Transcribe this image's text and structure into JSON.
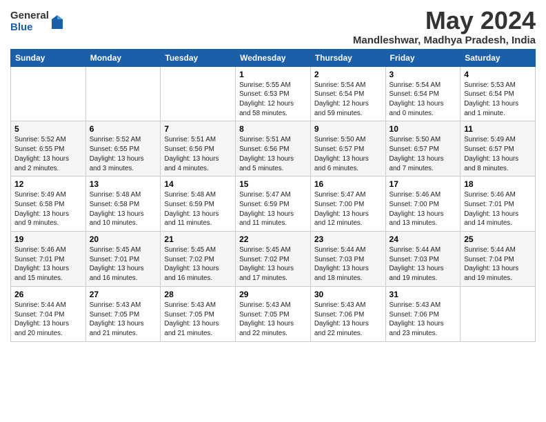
{
  "logo": {
    "general": "General",
    "blue": "Blue"
  },
  "title": "May 2024",
  "location": "Mandleshwar, Madhya Pradesh, India",
  "days_header": [
    "Sunday",
    "Monday",
    "Tuesday",
    "Wednesday",
    "Thursday",
    "Friday",
    "Saturday"
  ],
  "weeks": [
    [
      {
        "day": "",
        "info": ""
      },
      {
        "day": "",
        "info": ""
      },
      {
        "day": "",
        "info": ""
      },
      {
        "day": "1",
        "info": "Sunrise: 5:55 AM\nSunset: 6:53 PM\nDaylight: 12 hours\nand 58 minutes."
      },
      {
        "day": "2",
        "info": "Sunrise: 5:54 AM\nSunset: 6:54 PM\nDaylight: 12 hours\nand 59 minutes."
      },
      {
        "day": "3",
        "info": "Sunrise: 5:54 AM\nSunset: 6:54 PM\nDaylight: 13 hours\nand 0 minutes."
      },
      {
        "day": "4",
        "info": "Sunrise: 5:53 AM\nSunset: 6:54 PM\nDaylight: 13 hours\nand 1 minute."
      }
    ],
    [
      {
        "day": "5",
        "info": "Sunrise: 5:52 AM\nSunset: 6:55 PM\nDaylight: 13 hours\nand 2 minutes."
      },
      {
        "day": "6",
        "info": "Sunrise: 5:52 AM\nSunset: 6:55 PM\nDaylight: 13 hours\nand 3 minutes."
      },
      {
        "day": "7",
        "info": "Sunrise: 5:51 AM\nSunset: 6:56 PM\nDaylight: 13 hours\nand 4 minutes."
      },
      {
        "day": "8",
        "info": "Sunrise: 5:51 AM\nSunset: 6:56 PM\nDaylight: 13 hours\nand 5 minutes."
      },
      {
        "day": "9",
        "info": "Sunrise: 5:50 AM\nSunset: 6:57 PM\nDaylight: 13 hours\nand 6 minutes."
      },
      {
        "day": "10",
        "info": "Sunrise: 5:50 AM\nSunset: 6:57 PM\nDaylight: 13 hours\nand 7 minutes."
      },
      {
        "day": "11",
        "info": "Sunrise: 5:49 AM\nSunset: 6:57 PM\nDaylight: 13 hours\nand 8 minutes."
      }
    ],
    [
      {
        "day": "12",
        "info": "Sunrise: 5:49 AM\nSunset: 6:58 PM\nDaylight: 13 hours\nand 9 minutes."
      },
      {
        "day": "13",
        "info": "Sunrise: 5:48 AM\nSunset: 6:58 PM\nDaylight: 13 hours\nand 10 minutes."
      },
      {
        "day": "14",
        "info": "Sunrise: 5:48 AM\nSunset: 6:59 PM\nDaylight: 13 hours\nand 11 minutes."
      },
      {
        "day": "15",
        "info": "Sunrise: 5:47 AM\nSunset: 6:59 PM\nDaylight: 13 hours\nand 11 minutes."
      },
      {
        "day": "16",
        "info": "Sunrise: 5:47 AM\nSunset: 7:00 PM\nDaylight: 13 hours\nand 12 minutes."
      },
      {
        "day": "17",
        "info": "Sunrise: 5:46 AM\nSunset: 7:00 PM\nDaylight: 13 hours\nand 13 minutes."
      },
      {
        "day": "18",
        "info": "Sunrise: 5:46 AM\nSunset: 7:01 PM\nDaylight: 13 hours\nand 14 minutes."
      }
    ],
    [
      {
        "day": "19",
        "info": "Sunrise: 5:46 AM\nSunset: 7:01 PM\nDaylight: 13 hours\nand 15 minutes."
      },
      {
        "day": "20",
        "info": "Sunrise: 5:45 AM\nSunset: 7:01 PM\nDaylight: 13 hours\nand 16 minutes."
      },
      {
        "day": "21",
        "info": "Sunrise: 5:45 AM\nSunset: 7:02 PM\nDaylight: 13 hours\nand 16 minutes."
      },
      {
        "day": "22",
        "info": "Sunrise: 5:45 AM\nSunset: 7:02 PM\nDaylight: 13 hours\nand 17 minutes."
      },
      {
        "day": "23",
        "info": "Sunrise: 5:44 AM\nSunset: 7:03 PM\nDaylight: 13 hours\nand 18 minutes."
      },
      {
        "day": "24",
        "info": "Sunrise: 5:44 AM\nSunset: 7:03 PM\nDaylight: 13 hours\nand 19 minutes."
      },
      {
        "day": "25",
        "info": "Sunrise: 5:44 AM\nSunset: 7:04 PM\nDaylight: 13 hours\nand 19 minutes."
      }
    ],
    [
      {
        "day": "26",
        "info": "Sunrise: 5:44 AM\nSunset: 7:04 PM\nDaylight: 13 hours\nand 20 minutes."
      },
      {
        "day": "27",
        "info": "Sunrise: 5:43 AM\nSunset: 7:05 PM\nDaylight: 13 hours\nand 21 minutes."
      },
      {
        "day": "28",
        "info": "Sunrise: 5:43 AM\nSunset: 7:05 PM\nDaylight: 13 hours\nand 21 minutes."
      },
      {
        "day": "29",
        "info": "Sunrise: 5:43 AM\nSunset: 7:05 PM\nDaylight: 13 hours\nand 22 minutes."
      },
      {
        "day": "30",
        "info": "Sunrise: 5:43 AM\nSunset: 7:06 PM\nDaylight: 13 hours\nand 22 minutes."
      },
      {
        "day": "31",
        "info": "Sunrise: 5:43 AM\nSunset: 7:06 PM\nDaylight: 13 hours\nand 23 minutes."
      },
      {
        "day": "",
        "info": ""
      }
    ]
  ]
}
